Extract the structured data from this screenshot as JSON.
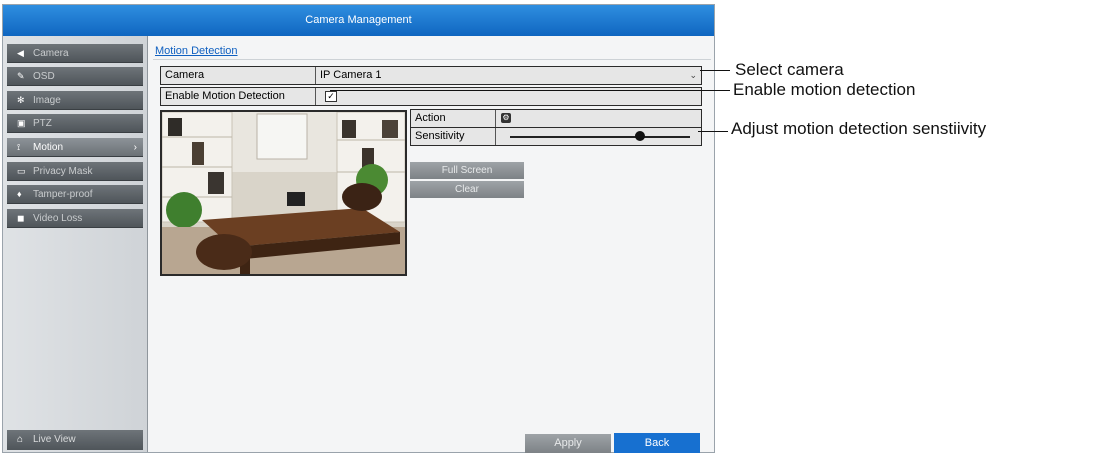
{
  "window": {
    "title": "Camera Management"
  },
  "sidebar": {
    "items": [
      {
        "label": "Camera",
        "icon": "camera-icon"
      },
      {
        "label": "OSD",
        "icon": "osd-icon"
      },
      {
        "label": "Image",
        "icon": "image-icon"
      },
      {
        "label": "PTZ",
        "icon": "ptz-icon"
      },
      {
        "label": "Motion",
        "icon": "motion-icon",
        "active": true
      },
      {
        "label": "Privacy Mask",
        "icon": "privacy-mask-icon"
      },
      {
        "label": "Tamper-proof",
        "icon": "tamper-proof-icon"
      },
      {
        "label": "Video Loss",
        "icon": "video-loss-icon"
      }
    ],
    "live_view": "Live View"
  },
  "main": {
    "section_title": "Motion Detection",
    "camera_label": "Camera",
    "camera_value": "IP Camera 1",
    "enable_label": "Enable Motion Detection",
    "enable_checked": true,
    "action_label": "Action",
    "sensitivity_label": "Sensitivity",
    "sensitivity_level": 0.72,
    "full_screen_label": "Full Screen",
    "clear_label": "Clear",
    "apply_label": "Apply",
    "back_label": "Back"
  },
  "callouts": {
    "select_camera": "Select camera",
    "enable_motion": "Enable motion detection",
    "adjust_sensitivity": "Adjust motion detection senstiivity"
  },
  "colors": {
    "title_bar": "#1a75d2",
    "accent_blue": "#1770d0",
    "sidebar_item": "#5c6267"
  }
}
